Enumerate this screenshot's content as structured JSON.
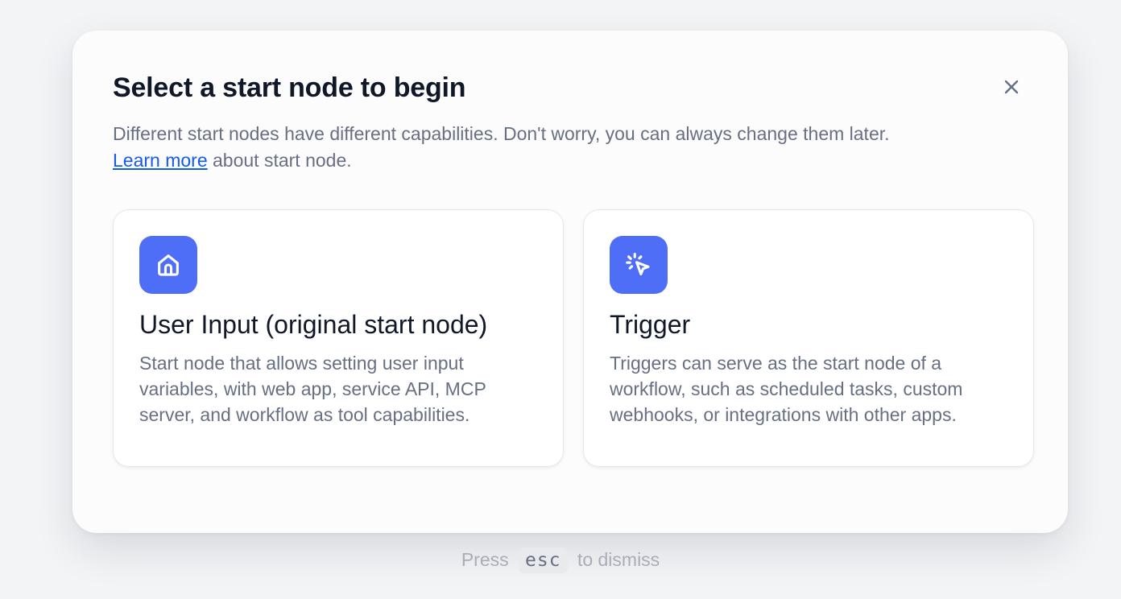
{
  "dialog": {
    "title": "Select a start node to begin",
    "description_text": "Different start nodes have different capabilities. Don't worry, you can always change them later.",
    "learn_more_link": "Learn more",
    "description_suffix": " about start node.",
    "close_icon": "close-icon"
  },
  "options": [
    {
      "icon": "home-icon",
      "title": "User Input (original start node)",
      "description": "Start node that allows setting user input variables, with web app, service API, MCP server, and workflow as tool capabilities."
    },
    {
      "icon": "cursor-click-icon",
      "title": "Trigger",
      "description": "Triggers can serve as the start node of a workflow, such as scheduled tasks, custom webhooks, or integrations with other apps."
    }
  ],
  "footer_hint": {
    "prefix": "Press",
    "key": "esc",
    "suffix": "to dismiss"
  },
  "colors": {
    "accent": "#4f6ef7",
    "link": "#155aef",
    "title": "#101828",
    "muted": "#676f83"
  }
}
